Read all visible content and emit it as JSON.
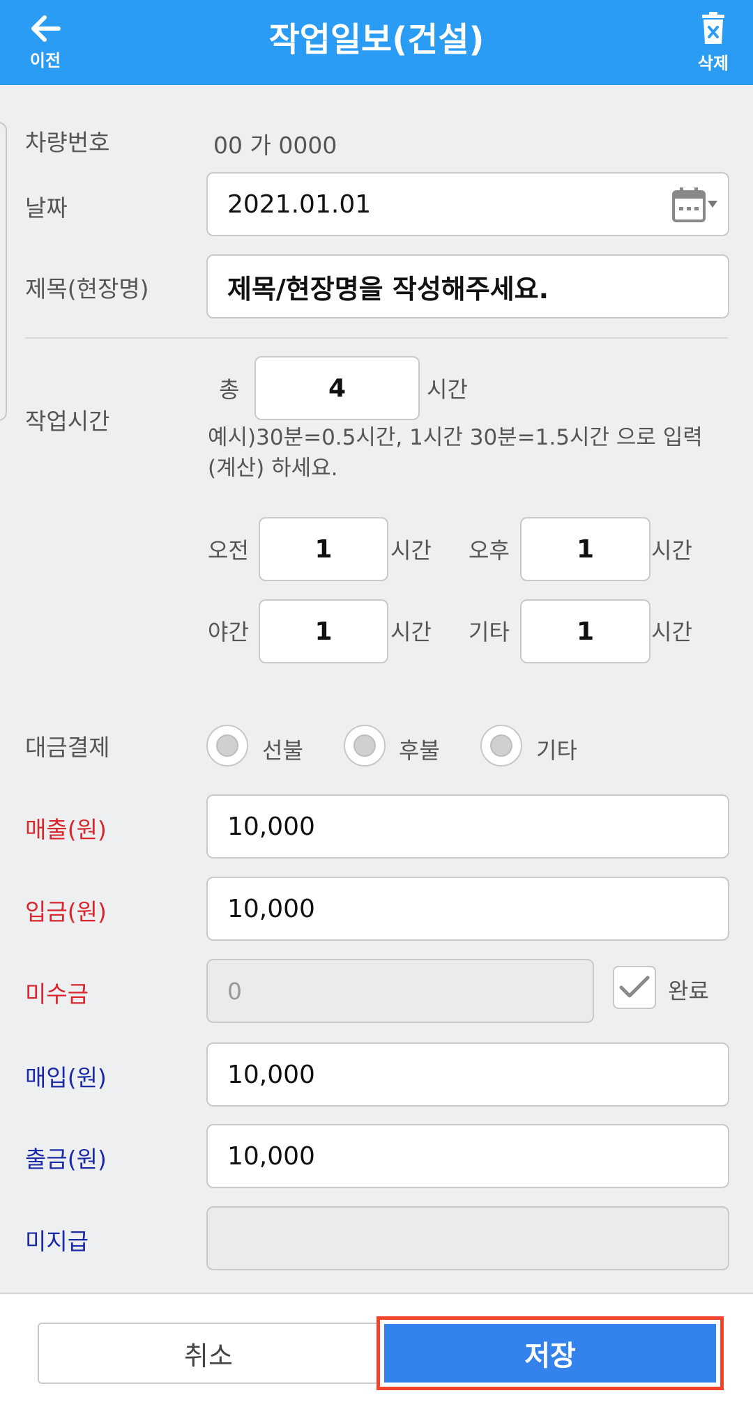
{
  "header": {
    "back_label": "이전",
    "title": "작업일보(건설)",
    "delete_label": "삭제"
  },
  "form": {
    "vehicle": {
      "label": "차량번호",
      "value": "00 가 0000"
    },
    "date": {
      "label": "날짜",
      "value": "2021.01.01"
    },
    "title_field": {
      "label": "제목(현장명)",
      "placeholder": "제목/현장명을 작성해주세요."
    },
    "work_time": {
      "label": "작업시간",
      "total_prefix": "총",
      "total_value": "4",
      "unit": "시간",
      "hint": "예시)30분=0.5시간, 1시간 30분=1.5시간 으로 입력(계산) 하세요.",
      "am": {
        "label": "오전",
        "value": "1"
      },
      "pm": {
        "label": "오후",
        "value": "1"
      },
      "night": {
        "label": "야간",
        "value": "1"
      },
      "etc": {
        "label": "기타",
        "value": "1"
      }
    },
    "payment": {
      "label": "대금결제",
      "options": [
        "선불",
        "후불",
        "기타"
      ]
    },
    "sales": {
      "label": "매출(원)",
      "value": "10,000"
    },
    "deposit": {
      "label": "입금(원)",
      "value": "10,000"
    },
    "receivable": {
      "label": "미수금",
      "value": "0",
      "complete_label": "완료"
    },
    "purchase": {
      "label": "매입(원)",
      "value": "10,000"
    },
    "withdrawal": {
      "label": "출금(원)",
      "value": "10,000"
    },
    "unpaid": {
      "label": "미지급",
      "value": ""
    }
  },
  "footer": {
    "cancel_label": "취소",
    "save_label": "저장"
  },
  "colors": {
    "header": "#2b9cf3",
    "save_button": "#3482ec",
    "highlight": "#f0452a",
    "red_label": "#d9262c",
    "blue_label": "#1b2aa8"
  }
}
